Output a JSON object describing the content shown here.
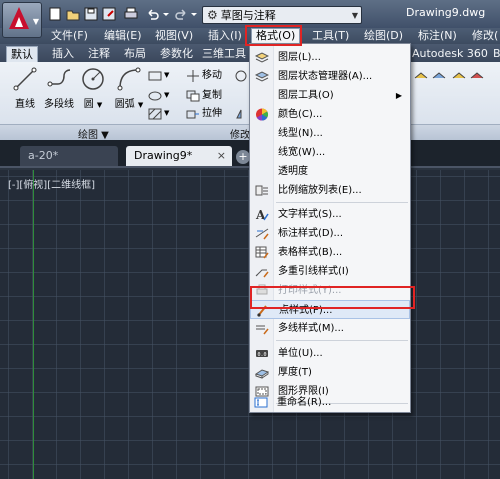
{
  "title_bar": {
    "workspace": "草图与注释",
    "document_title": "Drawing9.dwg"
  },
  "menu_bar": [
    {
      "label": "文件(F)"
    },
    {
      "label": "编辑(E)"
    },
    {
      "label": "视图(V)"
    },
    {
      "label": "插入(I)"
    },
    {
      "label": "格式(O)"
    },
    {
      "label": "工具(T)"
    },
    {
      "label": "绘图(D)"
    },
    {
      "label": "标注(N)"
    },
    {
      "label": "修改("
    }
  ],
  "ribbon_tabs": [
    "默认",
    "插入",
    "注释",
    "布局",
    "参数化",
    "三维工具",
    "Autodesk 360",
    "B"
  ],
  "ribbon": {
    "draw_tools": [
      "直线",
      "多段线",
      "圆",
      "圆弧"
    ],
    "modify_tools": [
      "移动",
      "复制",
      "拉伸"
    ],
    "panel_draw": "绘图 ▼",
    "panel_modify": "修改"
  },
  "doc_tabs": {
    "tab1": "a-20*",
    "tab2": "Drawing9*",
    "close": "×",
    "plus": "+"
  },
  "viewport_label": "[-][俯视][二维线框]",
  "format_menu": {
    "items": [
      {
        "label": "图层(L)...",
        "icon": "layers-icon"
      },
      {
        "label": "图层状态管理器(A)...",
        "icon": "layer-state-icon"
      },
      {
        "label": "图层工具(O)",
        "icon": "",
        "submenu": "▶"
      },
      {
        "label": "颜色(C)...",
        "icon": "color-wheel-icon"
      },
      {
        "label": "线型(N)...",
        "icon": ""
      },
      {
        "label": "线宽(W)...",
        "icon": ""
      },
      {
        "label": "透明度",
        "icon": ""
      },
      {
        "label": "比例缩放列表(E)...",
        "icon": "scale-list-icon"
      },
      {
        "label": "文字样式(S)...",
        "icon": "text-style-icon"
      },
      {
        "label": "标注样式(D)...",
        "icon": "dim-style-icon"
      },
      {
        "label": "表格样式(B)...",
        "icon": "table-style-icon"
      },
      {
        "label": "多重引线样式(I)",
        "icon": "mleader-style-icon"
      },
      {
        "label": "打印样式(Y)...",
        "icon": "plot-style-icon",
        "disabled": true
      },
      {
        "label": "点样式(P)...",
        "icon": "point-style-icon",
        "highlighted": true
      },
      {
        "label": "多线样式(M)...",
        "icon": "mline-style-icon"
      },
      {
        "label": "单位(U)...",
        "icon": "units-icon"
      },
      {
        "label": "厚度(T)",
        "icon": "thickness-icon"
      },
      {
        "label": "图形界限(I)",
        "icon": "limits-icon"
      },
      {
        "label": "重命名(R)...",
        "icon": "rename-icon"
      }
    ]
  },
  "colors": {
    "highlight_box": "#e02424",
    "autocad_red": "#c8102e"
  }
}
